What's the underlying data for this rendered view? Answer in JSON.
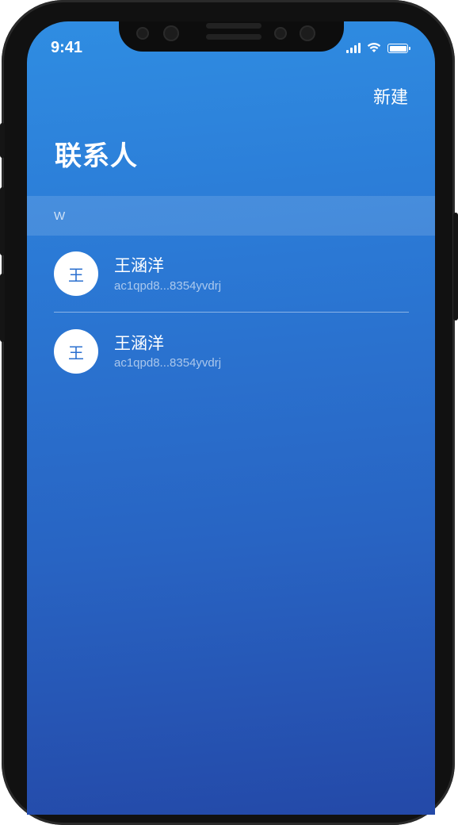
{
  "status_bar": {
    "time": "9:41",
    "icons": [
      "cellular-signal-icon",
      "wifi-icon",
      "battery-icon"
    ]
  },
  "header": {
    "new_label": "新建",
    "title": "联系人"
  },
  "section": {
    "letter": "W"
  },
  "contacts": [
    {
      "avatar_text": "王",
      "name": "王涵洋",
      "address": "ac1qpd8...8354yvdrj"
    },
    {
      "avatar_text": "王",
      "name": "王涵洋",
      "address": "ac1qpd8...8354yvdrj"
    }
  ],
  "colors": {
    "background_top": "#2f8de2",
    "background_bottom": "#2449a8",
    "avatar_bg": "#ffffff",
    "avatar_text": "#2a6fcf"
  }
}
